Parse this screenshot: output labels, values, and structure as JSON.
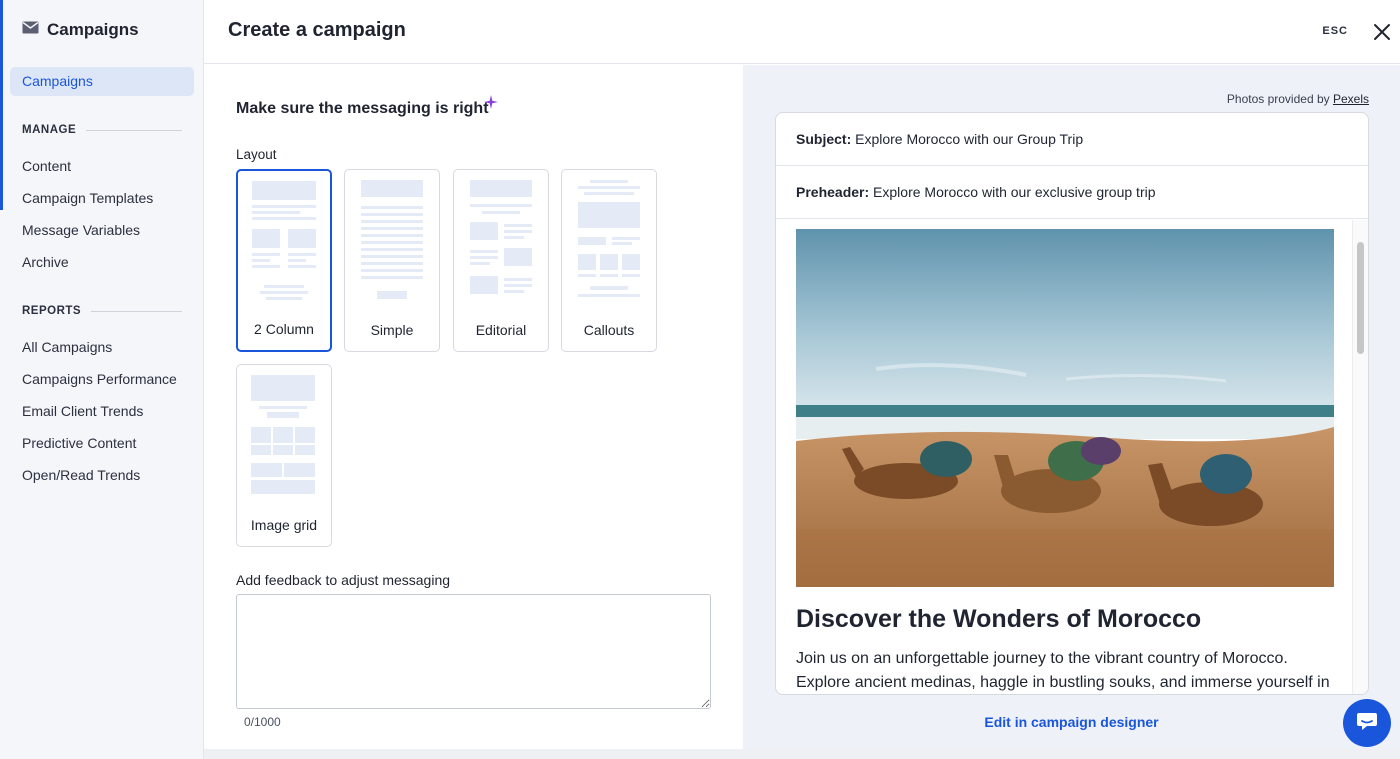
{
  "sidebar": {
    "brand": "Campaigns",
    "active_item": "Campaigns",
    "manage_heading": "MANAGE",
    "manage_items": [
      "Content",
      "Campaign Templates",
      "Message Variables",
      "Archive"
    ],
    "reports_heading": "REPORTS",
    "reports_items": [
      "All Campaigns",
      "Campaigns Performance",
      "Email Client Trends",
      "Predictive Content",
      "Open/Read Trends"
    ]
  },
  "header": {
    "title": "Create a campaign",
    "esc_label": "ESC",
    "close_icon": "close-icon"
  },
  "form": {
    "title": "Make sure the messaging is right",
    "layout_label": "Layout",
    "layouts": [
      {
        "name": "2 Column",
        "selected": true
      },
      {
        "name": "Simple",
        "selected": false
      },
      {
        "name": "Editorial",
        "selected": false
      },
      {
        "name": "Callouts",
        "selected": false
      },
      {
        "name": "Image grid",
        "selected": false
      }
    ],
    "feedback_label": "Add feedback to adjust messaging",
    "feedback_value": "",
    "counter": "0/1000"
  },
  "preview": {
    "photos_credit": "Photos provided by",
    "photos_link": "Pexels",
    "subject_label": "Subject:",
    "subject_value": "Explore Morocco with our Group Trip",
    "preheader_label": "Preheader:",
    "preheader_value": "Explore Morocco with our exclusive group trip",
    "headline": "Discover the Wonders of Morocco",
    "body": "Join us on an unforgettable journey to the vibrant country of Morocco. Explore ancient medinas, haggle in bustling souks, and immerse yourself in",
    "edit_link": "Edit in campaign designer"
  },
  "colors": {
    "accent": "#1a56db",
    "sidebar_bg": "#f5f6f9",
    "preview_bg": "#eef1f8"
  }
}
